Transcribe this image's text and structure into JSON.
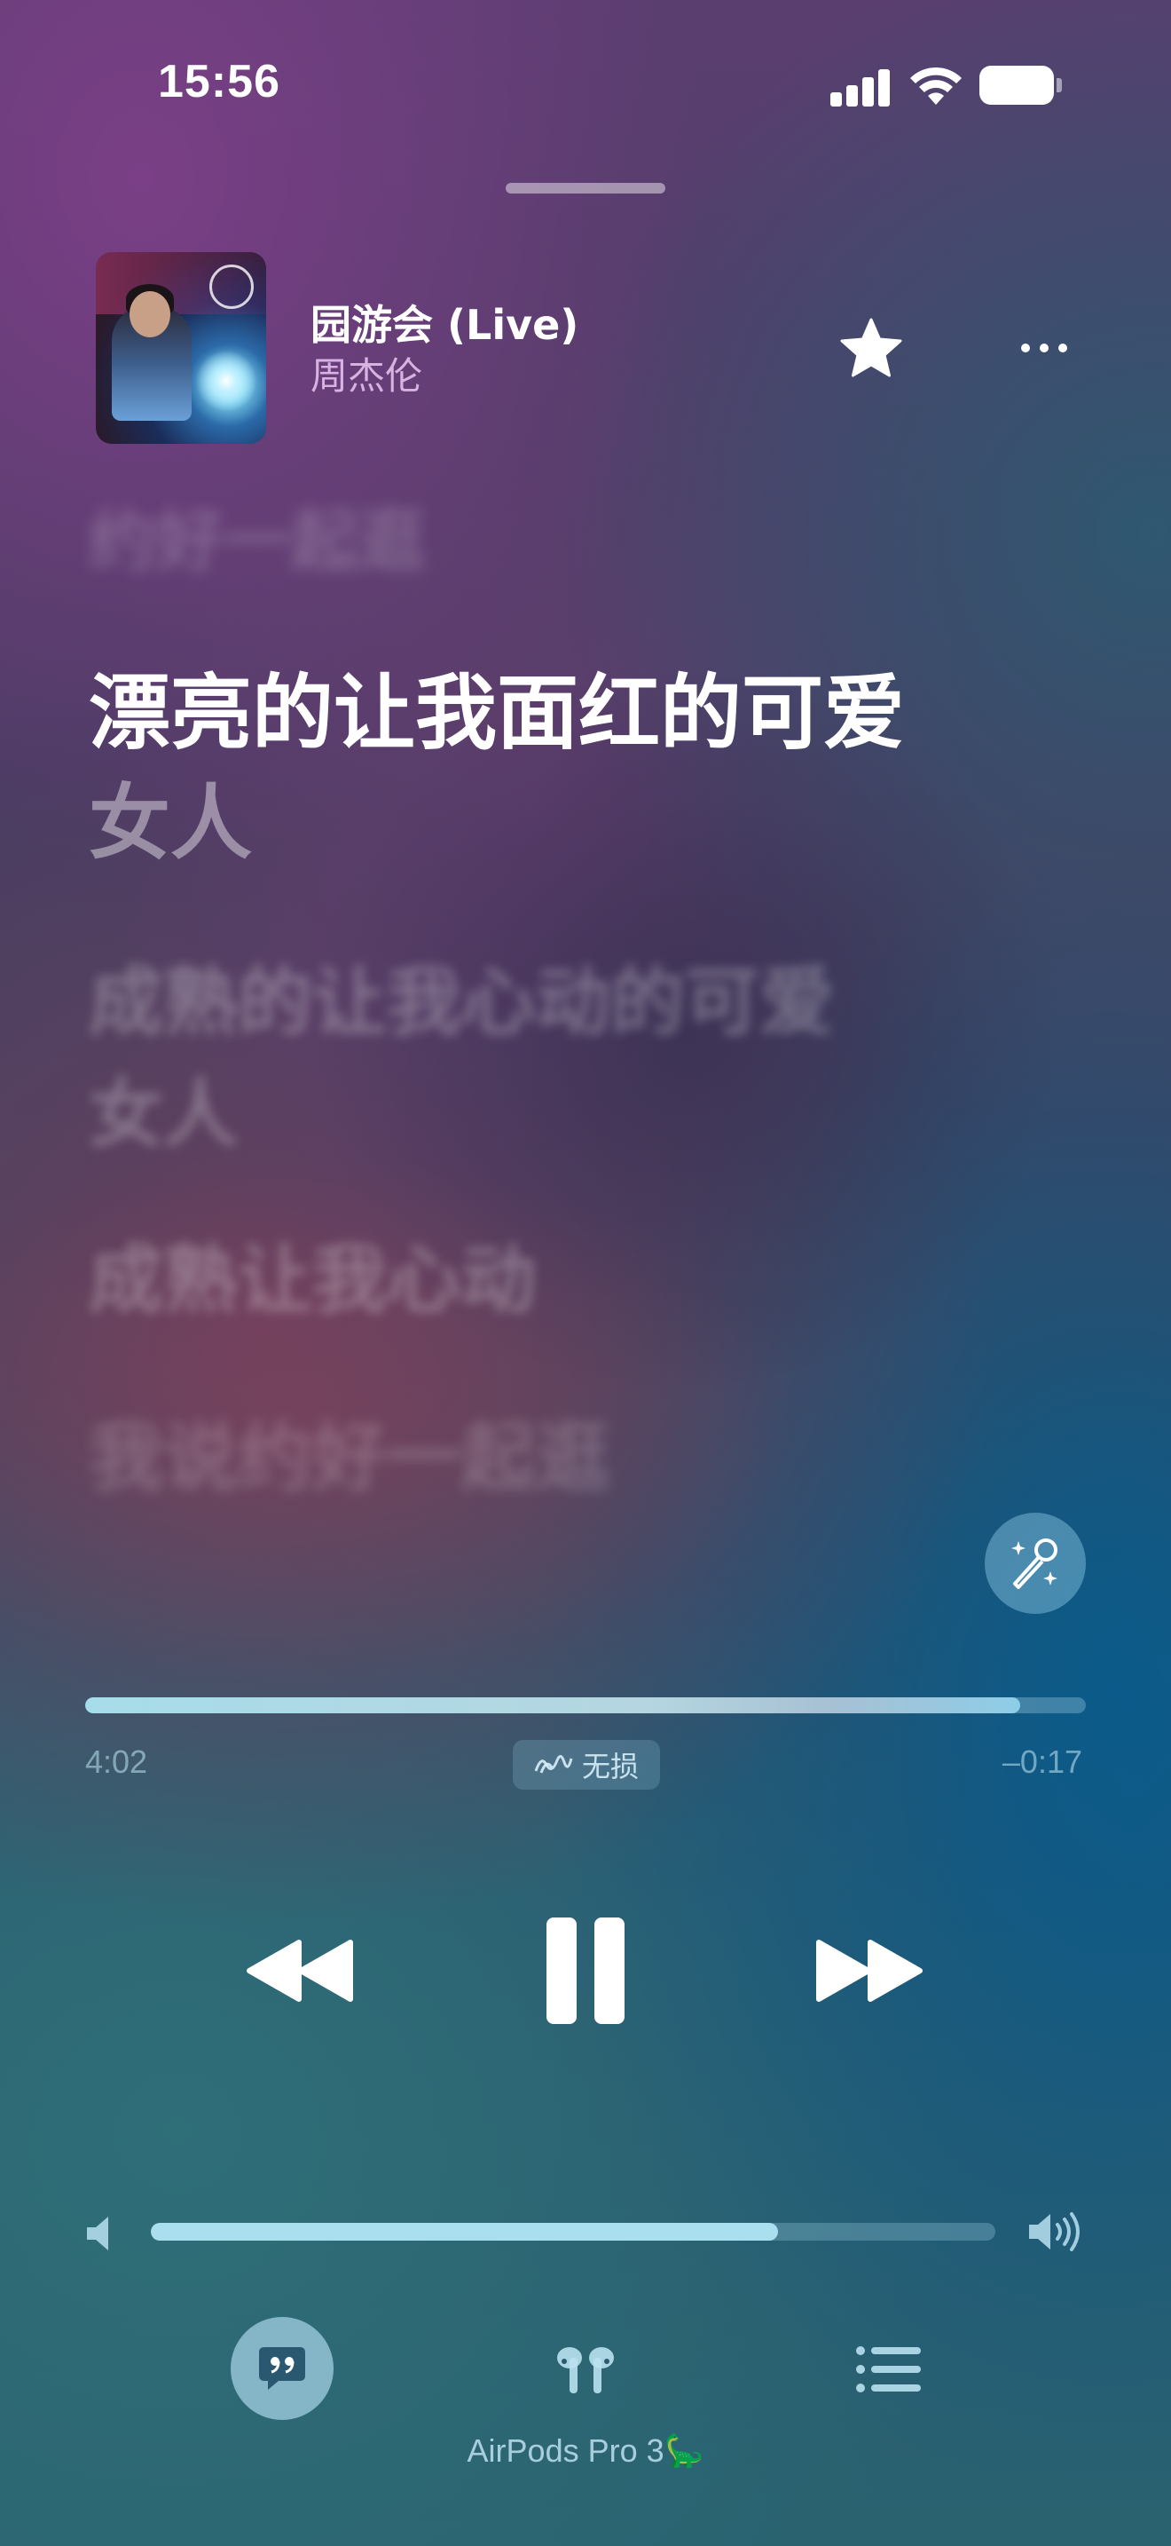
{
  "status_bar": {
    "time": "15:56"
  },
  "now_playing": {
    "title": "园游会 (Live)",
    "artist": "周杰伦"
  },
  "lyrics": {
    "previous": "约好一起逛",
    "current_line1": "漂亮的让我面红的可爱",
    "current_line2": "女人",
    "next1_line1": "成熟的让我心动的可爱",
    "next1_line2": "女人",
    "next2": "成熟让我心动",
    "next3": "我说约好一起逛"
  },
  "playback": {
    "elapsed": "4:02",
    "remaining": "–0:17",
    "progress_fraction": 0.934,
    "quality_label": "无损"
  },
  "volume": {
    "level_fraction": 0.743
  },
  "output_device": "AirPods Pro 3🦕",
  "icons": {
    "star": "star-icon",
    "more": "ellipsis-icon",
    "sing": "microphone-sparkles-icon",
    "rewind": "backward-icon",
    "pause": "pause-icon",
    "forward": "forward-icon",
    "lyrics": "quote-bubble-icon",
    "airplay": "airpods-icon",
    "queue": "list-icon"
  }
}
